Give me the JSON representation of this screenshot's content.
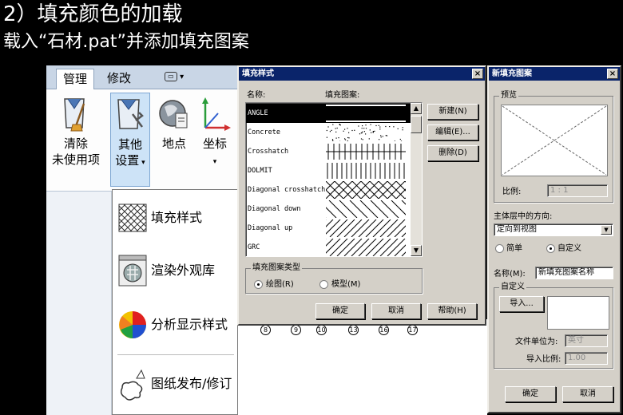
{
  "slide": {
    "title": "2）填充颜色的加载",
    "subtitle": "载入“石材.pat”并添加填充图案"
  },
  "ribbon": {
    "tabs": [
      {
        "label": "管理",
        "active": true
      },
      {
        "label": "修改",
        "active": false
      }
    ],
    "buttons": {
      "purge": {
        "line1": "清除",
        "line2": "未使用项"
      },
      "other_settings": {
        "line1": "其他",
        "line2": "设置"
      },
      "location": {
        "label": "地点"
      },
      "coordinates": {
        "label": "坐标"
      }
    },
    "dropdown_items": [
      {
        "label": "填充样式",
        "icon": "hatch-pattern-icon"
      },
      {
        "label": "渲染外观库",
        "icon": "render-library-icon"
      },
      {
        "label": "分析显示样式",
        "icon": "analysis-style-icon"
      },
      {
        "label": "图纸发布/修订",
        "icon": "sheet-issues-icon"
      }
    ]
  },
  "fill_dialog": {
    "title": "填充样式",
    "col_name": "名称:",
    "col_pattern": "填充图案:",
    "rows": [
      {
        "name": "ANGLE",
        "selected": true,
        "pattern": "solid"
      },
      {
        "name": "Concrete",
        "selected": false,
        "pattern": "dots"
      },
      {
        "name": "Crosshatch",
        "selected": false,
        "pattern": "crosshatch"
      },
      {
        "name": "DOLMIT",
        "selected": false,
        "pattern": "vertical"
      },
      {
        "name": "Diagonal crosshatch",
        "selected": false,
        "pattern": "diag-cross"
      },
      {
        "name": "Diagonal down",
        "selected": false,
        "pattern": "diag-down"
      },
      {
        "name": "Diagonal up",
        "selected": false,
        "pattern": "diag-up"
      },
      {
        "name": "GRC",
        "selected": false,
        "pattern": "diag-up"
      }
    ],
    "btn_new": "新建(N)",
    "btn_edit": "编辑(E)...",
    "btn_delete": "删除(D)",
    "type_group": "填充图案类型",
    "radio_drafting": "绘图(R)",
    "radio_model": "模型(M)",
    "btn_ok": "确定",
    "btn_cancel": "取消",
    "btn_help": "帮助(H)"
  },
  "new_pattern_dialog": {
    "title": "新填充图案",
    "preview_label": "预览",
    "scale_label": "比例:",
    "scale_value": "1 : 1",
    "orientation_label": "主体层中的方向:",
    "orientation_value": "定向到视图",
    "radio_simple": "简单",
    "radio_custom": "自定义",
    "name_label": "名称(M):",
    "name_value": "新填充图案名称",
    "custom_group": "自定义",
    "btn_import": "导入...",
    "file_units_label": "文件单位为:",
    "file_units_value": "英寸",
    "import_scale_label": "导入比例:",
    "import_scale_value": "1.00",
    "btn_ok": "确定",
    "btn_cancel": "取消"
  },
  "grid_numbers": [
    "8",
    "9",
    "10",
    "13",
    "16",
    "17"
  ]
}
